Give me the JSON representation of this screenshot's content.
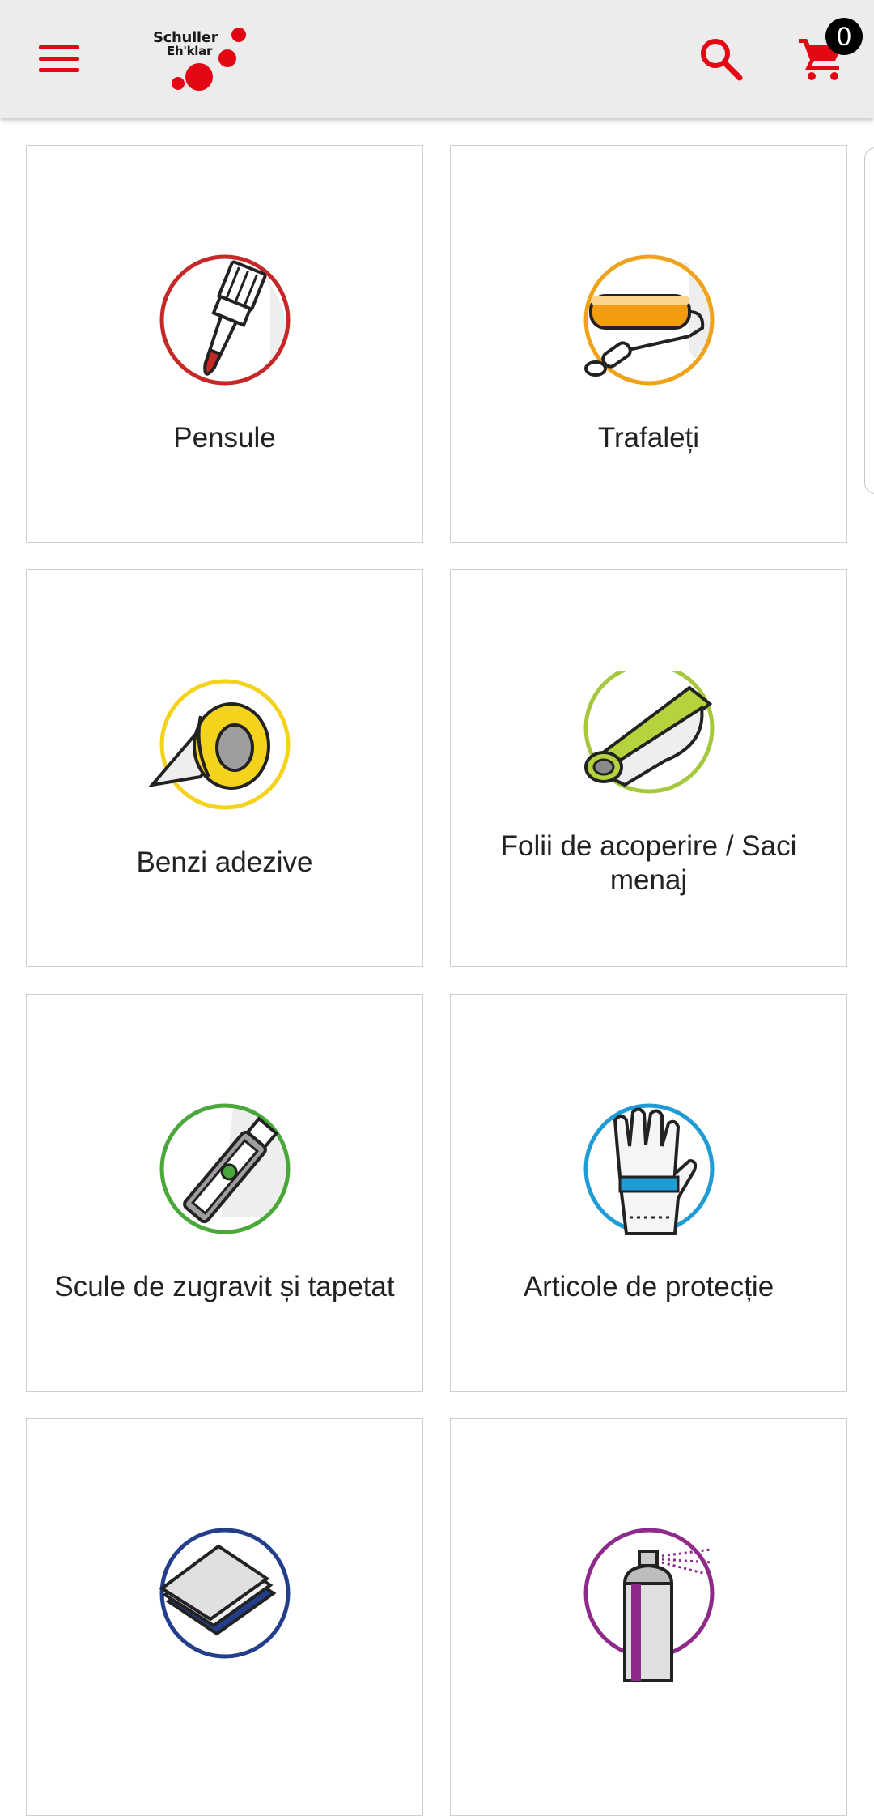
{
  "header": {
    "logo": {
      "line1": "Schuller",
      "line2": "Eh'klar"
    },
    "cart_count": "0",
    "brand_color": "#e30613"
  },
  "categories": [
    {
      "label": "Pensule",
      "icon": "paint-brush-icon",
      "ring_color": "#c62828"
    },
    {
      "label": "Trafaleți",
      "icon": "paint-roller-icon",
      "ring_color": "#f0a21b"
    },
    {
      "label": "Benzi adezive",
      "icon": "adhesive-tape-icon",
      "ring_color": "#f4d31c"
    },
    {
      "label": "Folii de acoperire / Saci menaj",
      "icon": "cover-foil-icon",
      "ring_color": "#a6c83c"
    },
    {
      "label": "Scule de zugravit și tapetat",
      "icon": "utility-knife-icon",
      "ring_color": "#4aa83a"
    },
    {
      "label": "Articole de protecție",
      "icon": "protective-glove-icon",
      "ring_color": "#1f9bd6"
    },
    {
      "label": "",
      "icon": "sandpaper-icon",
      "ring_color": "#233f8c"
    },
    {
      "label": "",
      "icon": "spray-can-icon",
      "ring_color": "#8e2a8a"
    }
  ]
}
